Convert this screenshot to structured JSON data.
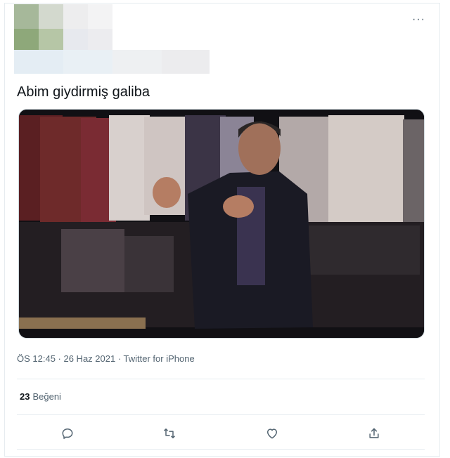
{
  "tweet": {
    "text": "Abim giydirmiş galiba",
    "meta": "ÖS 12:45 · 26 Haz 2021 · Twitter for iPhone",
    "likes_count": "23",
    "likes_label": "Beğeni"
  },
  "header": {
    "more_glyph": "···"
  },
  "actions": [
    {
      "icon": "reply-icon"
    },
    {
      "icon": "retweet-icon"
    },
    {
      "icon": "like-icon"
    },
    {
      "icon": "share-icon"
    }
  ],
  "colors": {
    "text": "#0f1419",
    "muted": "#536471",
    "border": "#e6ecf0"
  }
}
